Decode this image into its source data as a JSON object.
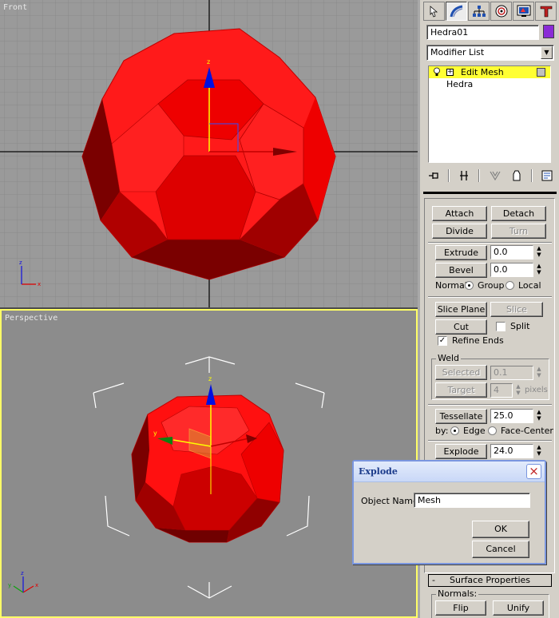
{
  "viewports": {
    "front_label": "Front",
    "perspective_label": "Perspective",
    "active": "Perspective",
    "gizmo_axes": {
      "x": "x",
      "y": "y",
      "z": "z"
    }
  },
  "object_color": "#8a2bd6",
  "mesh_color": "#ff0000",
  "panel": {
    "tabs": [
      {
        "icon": "create-icon"
      },
      {
        "icon": "modify-icon",
        "active": true
      },
      {
        "icon": "hierarchy-icon"
      },
      {
        "icon": "motion-icon"
      },
      {
        "icon": "display-icon"
      },
      {
        "icon": "utilities-icon"
      }
    ],
    "object_name": "Hedra01",
    "modifier_list": "Modifier List",
    "stack": [
      {
        "label": "Edit Mesh",
        "selected": true
      },
      {
        "label": "Hedra",
        "selected": false
      }
    ],
    "stack_tools": [
      "pin-stack-icon",
      "show-end-result-icon",
      "make-unique-icon",
      "remove-modifier-icon",
      "configure-modifier-sets-icon"
    ]
  },
  "edit_geometry": {
    "attach": "Attach",
    "detach": "Detach",
    "divide": "Divide",
    "turn": "Turn",
    "extrude": "Extrude",
    "extrude_value": "0.0",
    "bevel": "Bevel",
    "bevel_value": "0.0",
    "normal_label": "Normal:",
    "normal_group": "Group",
    "normal_local": "Local",
    "normal_selected": "Group",
    "slice_plane": "Slice Plane",
    "slice": "Slice",
    "cut": "Cut",
    "split": "Split",
    "split_checked": false,
    "refine_ends": "Refine Ends",
    "refine_ends_checked": true,
    "weld_title": "Weld",
    "weld_selected": "Selected",
    "weld_selected_value": "0.1",
    "weld_target": "Target",
    "weld_target_value": "4",
    "weld_pixels": "pixels",
    "tessellate": "Tessellate",
    "tessellate_value": "25.0",
    "by_label": "by:",
    "by_edge": "Edge",
    "by_face_center": "Face-Center",
    "by_selected": "Edge",
    "explode": "Explode",
    "explode_value": "24.0"
  },
  "surface_properties": {
    "title": "Surface Properties",
    "collapse_symbol": "-",
    "normals_title": "Normals:",
    "flip": "Flip",
    "unify": "Unify"
  },
  "dialog": {
    "title": "Explode",
    "object_name_label": "Object Name:",
    "object_name_value": "Mesh",
    "ok": "OK",
    "cancel": "Cancel",
    "close_symbol": "×"
  }
}
